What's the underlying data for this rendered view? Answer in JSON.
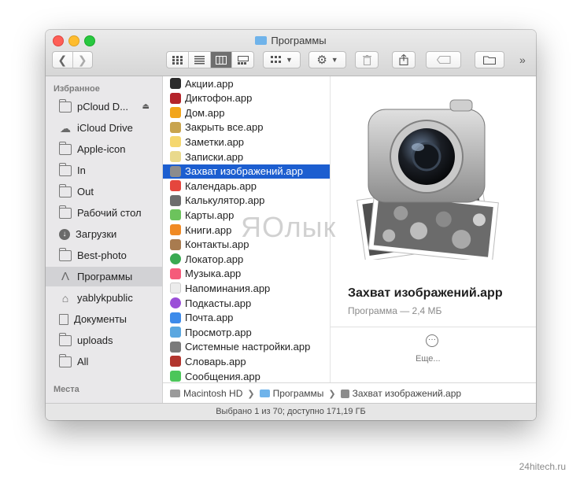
{
  "window": {
    "title": "Программы"
  },
  "toolbar": {
    "back_icon": "chevron-left",
    "forward_icon": "chevron-right",
    "view_icons": [
      "grid",
      "list",
      "columns",
      "gallery"
    ],
    "overflow_label": "»"
  },
  "sidebar": {
    "favorites_header": "Избранное",
    "places_header": "Места",
    "items": [
      {
        "label": "pCloud D...",
        "icon": "folder-icon"
      },
      {
        "label": "iCloud Drive",
        "icon": "cloud-icon"
      },
      {
        "label": "Apple-icon",
        "icon": "folder-icon"
      },
      {
        "label": "In",
        "icon": "folder-icon"
      },
      {
        "label": "Out",
        "icon": "folder-icon"
      },
      {
        "label": "Рабочий стол",
        "icon": "desktop-icon"
      },
      {
        "label": "Загрузки",
        "icon": "download-icon"
      },
      {
        "label": "Best-photo",
        "icon": "folder-icon"
      },
      {
        "label": "Программы",
        "icon": "applications-icon"
      },
      {
        "label": "yablykpublic",
        "icon": "home-icon"
      },
      {
        "label": "Документы",
        "icon": "documents-icon"
      },
      {
        "label": "uploads",
        "icon": "folder-icon"
      },
      {
        "label": "All",
        "icon": "folder-icon"
      }
    ],
    "selected_index": 8
  },
  "file_list": {
    "items": [
      {
        "label": "Акции.app",
        "color": "#2c2c2c"
      },
      {
        "label": "Диктофон.app",
        "color": "#b4242b"
      },
      {
        "label": "Дом.app",
        "color": "#f2a51b"
      },
      {
        "label": "Закрыть все.app",
        "color": "#c8a44e"
      },
      {
        "label": "Заметки.app",
        "color": "#f5d76e"
      },
      {
        "label": "Записки.app",
        "color": "#e9d98c"
      },
      {
        "label": "Захват изображений.app",
        "color": "#8c8c8c"
      },
      {
        "label": "Календарь.app",
        "color": "#e5463d"
      },
      {
        "label": "Калькулятор.app",
        "color": "#6d6d6d"
      },
      {
        "label": "Карты.app",
        "color": "#6cc35c"
      },
      {
        "label": "Книги.app",
        "color": "#f08a24"
      },
      {
        "label": "Контакты.app",
        "color": "#a87b4f"
      },
      {
        "label": "Локатор.app",
        "color": "#3aaa52"
      },
      {
        "label": "Музыка.app",
        "color": "#f55b7a"
      },
      {
        "label": "Напоминания.app",
        "color": "#ececec"
      },
      {
        "label": "Подкасты.app",
        "color": "#9b4fd8"
      },
      {
        "label": "Почта.app",
        "color": "#3d8bea"
      },
      {
        "label": "Просмотр.app",
        "color": "#5aa7e0"
      },
      {
        "label": "Системные настройки.app",
        "color": "#7a7a7a"
      },
      {
        "label": "Словарь.app",
        "color": "#b2352e"
      },
      {
        "label": "Сообщения.app",
        "color": "#4cc65a"
      }
    ],
    "selected_index": 6
  },
  "preview": {
    "name": "Захват изображений.app",
    "meta": "Программа — 2,4 МБ",
    "more_label": "Еще..."
  },
  "pathbar": {
    "segments": [
      "Macintosh HD",
      "Программы",
      "Захват изображений.app"
    ]
  },
  "status": {
    "text": "Выбрано 1 из 70; доступно 171,19 ГБ"
  },
  "watermark": "ЯОлык",
  "credit": "24hitech.ru"
}
